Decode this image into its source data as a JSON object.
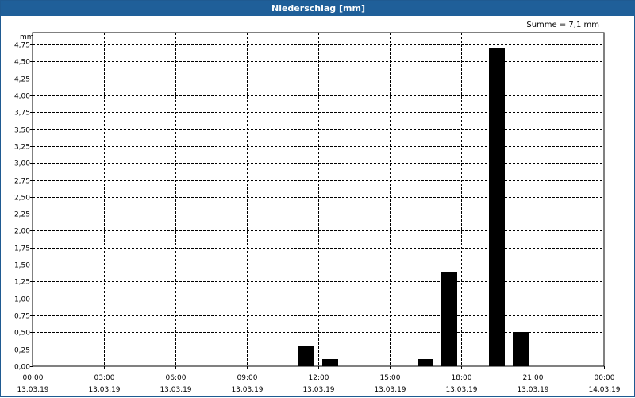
{
  "title": "Niederschlag [mm]",
  "summary": "Summe = 7,1 mm",
  "colors": {
    "titlebar": "#1f5f99",
    "bar": "#000000",
    "grid": "#000000",
    "background": "#ffffff"
  },
  "chart_data": {
    "type": "bar",
    "title": "Niederschlag [mm]",
    "ylabel": "mm",
    "ylim": [
      0,
      4.75
    ],
    "y_ticks": [
      "0,00",
      "0,25",
      "0,50",
      "0,75",
      "1,00",
      "1,25",
      "1,50",
      "1,75",
      "2,00",
      "2,25",
      "2,50",
      "2,75",
      "3,00",
      "3,25",
      "3,50",
      "3,75",
      "4,00",
      "4,25",
      "4,50",
      "4,75"
    ],
    "x_ticks": [
      {
        "time": "00:00",
        "date": "13.03.19"
      },
      {
        "time": "03:00",
        "date": "13.03.19"
      },
      {
        "time": "06:00",
        "date": "13.03.19"
      },
      {
        "time": "09:00",
        "date": "13.03.19"
      },
      {
        "time": "12:00",
        "date": "13.03.19"
      },
      {
        "time": "15:00",
        "date": "13.03.19"
      },
      {
        "time": "18:00",
        "date": "13.03.19"
      },
      {
        "time": "21:00",
        "date": "13.03.19"
      },
      {
        "time": "00:00",
        "date": "14.03.19"
      }
    ],
    "xlim": [
      "13.03.19 00:00",
      "14.03.19 00:00"
    ],
    "grid": true,
    "series": [
      {
        "points": [
          {
            "x": "13.03.19 11:30",
            "y": 0.3
          },
          {
            "x": "13.03.19 12:30",
            "y": 0.1
          },
          {
            "x": "13.03.19 16:30",
            "y": 0.1
          },
          {
            "x": "13.03.19 17:30",
            "y": 1.4
          },
          {
            "x": "13.03.19 19:30",
            "y": 4.7
          },
          {
            "x": "13.03.19 20:30",
            "y": 0.5
          }
        ]
      }
    ]
  }
}
